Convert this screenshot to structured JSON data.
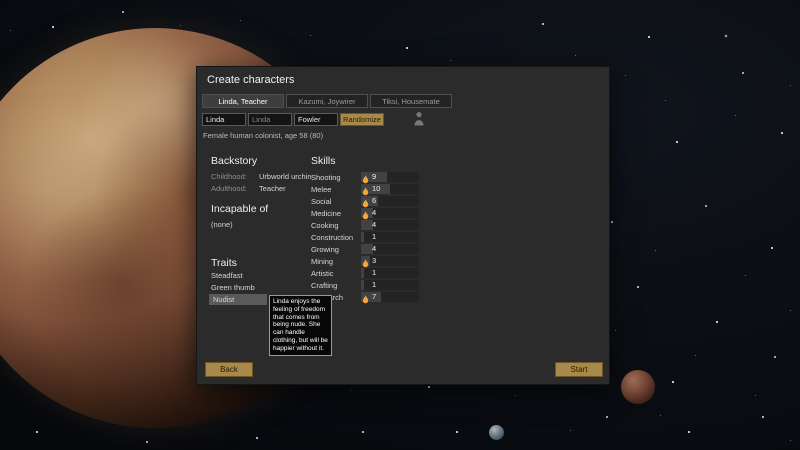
{
  "window": {
    "title": "Create characters"
  },
  "tabs": [
    {
      "label": "Linda, Teacher",
      "active": true
    },
    {
      "label": "Kazumi, Joywirer",
      "active": false
    },
    {
      "label": "Tiksi, Housemate",
      "active": false
    }
  ],
  "names": {
    "first": "Linda",
    "nick": "Linda",
    "last": "Fowler"
  },
  "labels": {
    "randomize": "Randomize",
    "back": "Back",
    "start": "Start"
  },
  "description": "Female human colonist, age 58 (80)",
  "backstory": {
    "heading": "Backstory",
    "childhood_label": "Childhood:",
    "childhood": "Urbworld urchin",
    "adulthood_label": "Adulthood:",
    "adulthood": "Teacher"
  },
  "incapable": {
    "heading": "Incapable of",
    "value": "(none)"
  },
  "traits": {
    "heading": "Traits",
    "items": [
      {
        "label": "Steadfast"
      },
      {
        "label": "Green thumb"
      },
      {
        "label": "Nudist",
        "hovered": true
      }
    ]
  },
  "skills": {
    "heading": "Skills",
    "max_level": 20,
    "items": [
      {
        "name": "Shooting",
        "level": 9,
        "passion": true
      },
      {
        "name": "Melee",
        "level": 10,
        "passion": true
      },
      {
        "name": "Social",
        "level": 6,
        "passion": true
      },
      {
        "name": "Medicine",
        "level": 4,
        "passion": true
      },
      {
        "name": "Cooking",
        "level": 4,
        "passion": false
      },
      {
        "name": "Construction",
        "level": 1,
        "passion": false
      },
      {
        "name": "Growing",
        "level": 4,
        "passion": false
      },
      {
        "name": "Mining",
        "level": 3,
        "passion": true
      },
      {
        "name": "Artistic",
        "level": 1,
        "passion": false
      },
      {
        "name": "Crafting",
        "level": 1,
        "passion": false
      },
      {
        "name": "Research",
        "level": 7,
        "passion": true
      }
    ]
  },
  "tooltip": {
    "text": "Linda enjoys the feeling of freedom that comes from being nude. She can handle clothing, but will be happier without it."
  },
  "colors": {
    "accent_button": "#a9894a",
    "passion_flame": "#f0a83c",
    "dialog_bg": "#2b2b2b"
  }
}
